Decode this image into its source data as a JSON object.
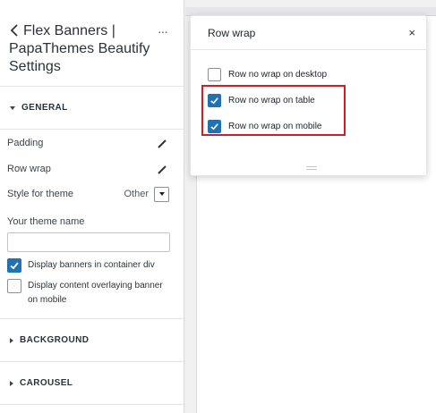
{
  "sidebar": {
    "title_line1": "Flex Banners |",
    "title_line2": "PapaThemes Beautify",
    "title_line3": "Settings",
    "more": "···",
    "general_label": "GENERAL",
    "padding_label": "Padding",
    "rowwrap_label": "Row wrap",
    "style_label": "Style for theme",
    "style_value": "Other",
    "theme_name_label": "Your theme name",
    "theme_name_value": "",
    "checkboxes": [
      {
        "label": "Display banners in container div",
        "checked": true
      },
      {
        "label_line1": "Display content overlaying banner",
        "label_line2": "on mobile",
        "checked": false
      }
    ],
    "background_label": "BACKGROUND",
    "carousel_label": "CAROUSEL"
  },
  "popup": {
    "title": "Row wrap",
    "close": "×",
    "options": [
      {
        "label": "Row no wrap on desktop",
        "checked": false
      },
      {
        "label": "Row no wrap on table",
        "checked": true
      },
      {
        "label": "Row no wrap on mobile",
        "checked": true
      }
    ]
  },
  "colors": {
    "accent": "#2271b1",
    "highlight": "#cc2027"
  },
  "icons": {
    "back": "chevron-left-icon",
    "edit": "pencil-icon",
    "check": "checkmark-icon",
    "close": "close-icon"
  }
}
